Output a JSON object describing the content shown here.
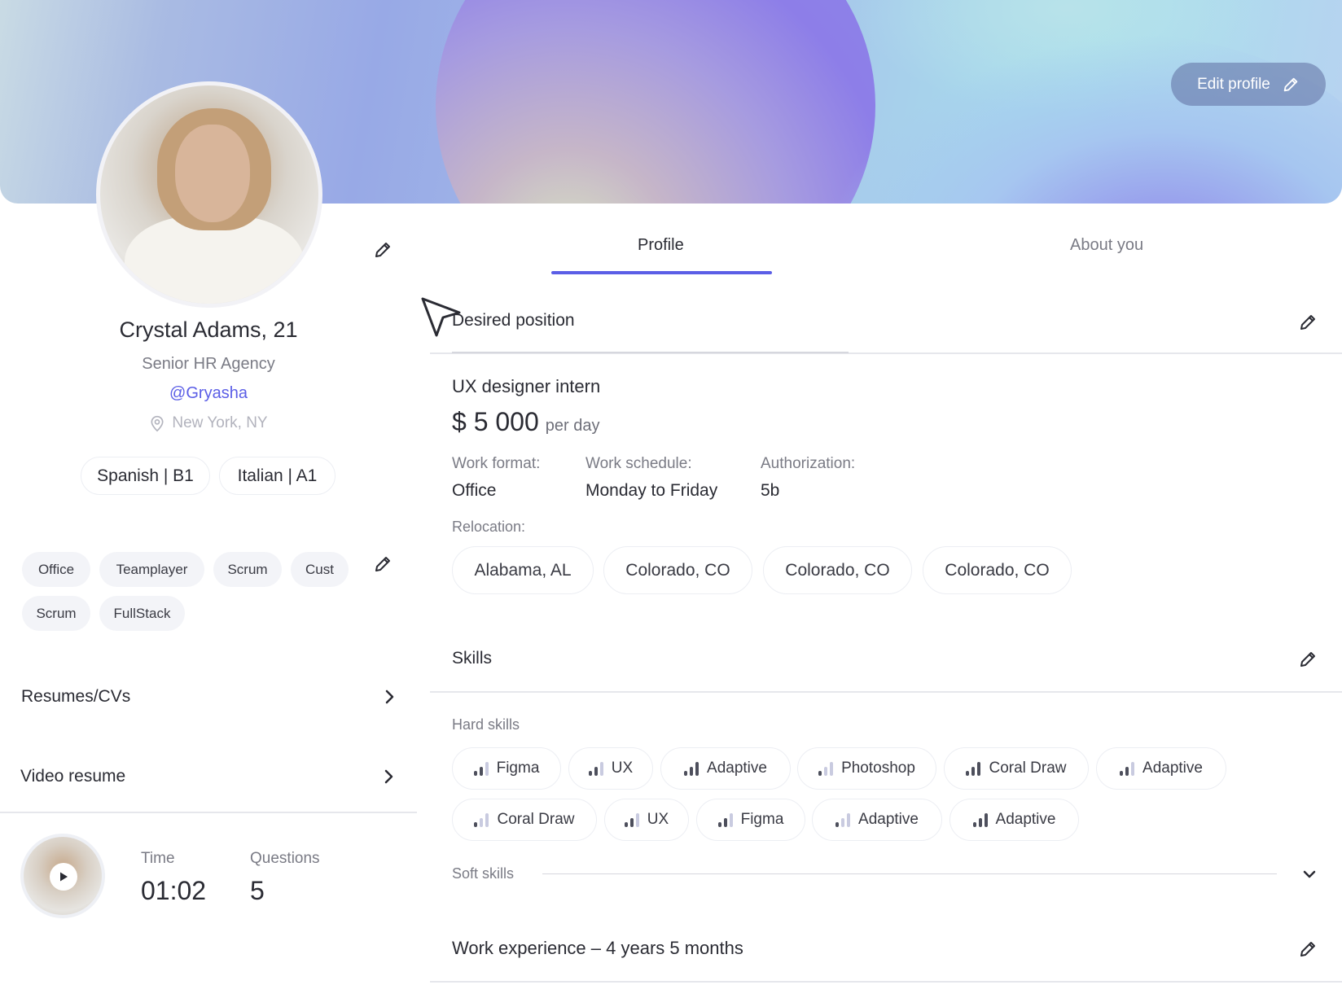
{
  "header": {
    "edit_profile_label": "Edit profile"
  },
  "profile": {
    "name": "Crystal Adams, 21",
    "role": "Senior HR Agency",
    "handle": "@Gryasha",
    "location": "New York, NY",
    "languages": [
      {
        "label": "Spanish | B1"
      },
      {
        "label": "Italian | A1"
      }
    ],
    "tags": [
      {
        "label": "Office"
      },
      {
        "label": "Teamplayer"
      },
      {
        "label": "Scrum"
      },
      {
        "label": "Cust"
      },
      {
        "label": "Scrum"
      },
      {
        "label": "FullStack"
      }
    ]
  },
  "sidebar": {
    "resumes_label": "Resumes/CVs",
    "video_resume_label": "Video resume",
    "time_label": "Time",
    "time_value": "01:02",
    "questions_label": "Questions",
    "questions_value": "5"
  },
  "tabs": [
    {
      "label": "Profile",
      "active": true
    },
    {
      "label": "About you",
      "active": false
    }
  ],
  "desired_position": {
    "title": "Desired position",
    "job": "UX designer intern",
    "salary": "$ 5 000",
    "salary_unit": "per day",
    "fields": [
      {
        "label": "Work format:",
        "value": "Office"
      },
      {
        "label": "Work schedule:",
        "value": "Monday to Friday"
      },
      {
        "label": "Authorization:",
        "value": "5b"
      }
    ],
    "relocation_label": "Relocation:",
    "relocation": [
      {
        "label": "Alabama, AL"
      },
      {
        "label": "Colorado, CO"
      },
      {
        "label": "Colorado, CO"
      },
      {
        "label": "Colorado, CO"
      }
    ]
  },
  "skills": {
    "title": "Skills",
    "hard_label": "Hard skills",
    "hard": [
      {
        "label": "Figma",
        "level": 2
      },
      {
        "label": "UX",
        "level": 2
      },
      {
        "label": "Adaptive",
        "level": 3
      },
      {
        "label": "Photoshop",
        "level": 1
      },
      {
        "label": "Coral Draw",
        "level": 3
      },
      {
        "label": "Adaptive",
        "level": 2
      },
      {
        "label": "Coral Draw",
        "level": 1
      },
      {
        "label": "UX",
        "level": 2
      },
      {
        "label": "Figma",
        "level": 2
      },
      {
        "label": "Adaptive",
        "level": 1
      },
      {
        "label": "Adaptive",
        "level": 3
      }
    ],
    "soft_label": "Soft skills"
  },
  "experience": {
    "title": "Work experience – 4 years 5 months"
  },
  "colors": {
    "accent": "#5b5ee6",
    "text": "#2a2b33",
    "muted": "#7a7b85",
    "chip_border": "#eceef3",
    "tag_bg": "#f3f4f8"
  },
  "icons": {
    "edit": "pencil-icon",
    "location": "map-pin-icon",
    "chevron_right": "chevron-right-icon",
    "chevron_down": "chevron-down-icon",
    "play": "play-icon",
    "skill_level": "signal-bars-icon"
  }
}
